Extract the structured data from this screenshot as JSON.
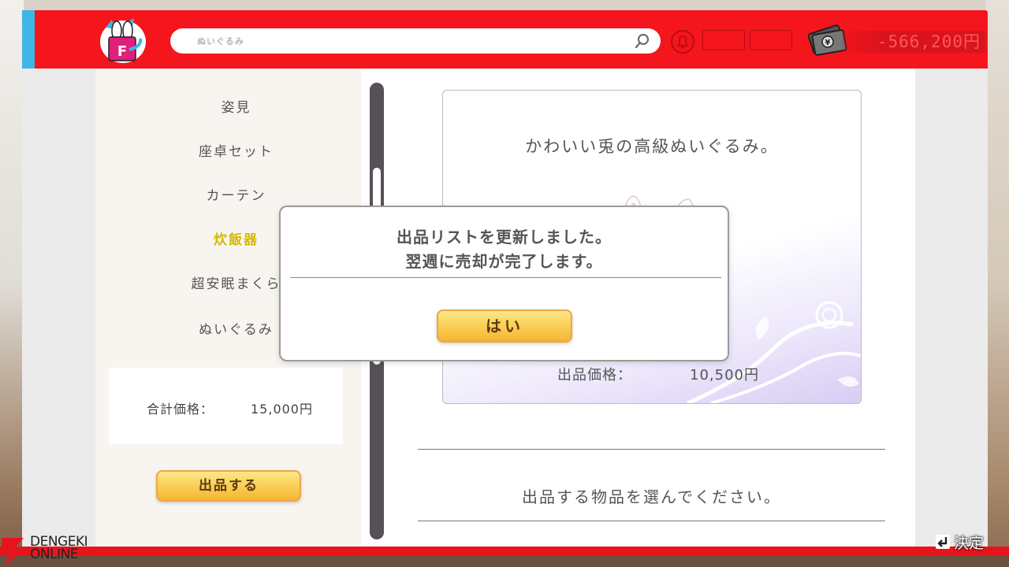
{
  "header": {
    "search_text": "ぬいぐるみ",
    "money": "-566,200円"
  },
  "sidebar": {
    "items": [
      {
        "label": "姿見"
      },
      {
        "label": "座卓セット"
      },
      {
        "label": "カーテン"
      },
      {
        "label": "炊飯器",
        "selected": true
      },
      {
        "label": "超安眠まくら"
      },
      {
        "label": "ぬいぐるみ"
      }
    ],
    "total_label": "合計価格：",
    "total_value": "15,000円",
    "list_button": "出品する"
  },
  "card": {
    "description": "かわいい兎の高級ぬいぐるみ。",
    "price_label": "出品価格：",
    "price_value": "10,500円"
  },
  "prompt": "出品する物品を選んでください。",
  "dialog": {
    "line1": "出品リストを更新しました。",
    "line2": "翌週に売却が完了します。",
    "yes_button": "はい"
  },
  "footer": {
    "confirm_label": "決定",
    "watermark_line1": "DENGEKI",
    "watermark_line2": "ONLINE"
  },
  "colors": {
    "header_red": "#f4151d",
    "accent_blue": "#3fb7e6",
    "button_yellow": "#fbd15a",
    "selected_item": "#d4b800"
  }
}
